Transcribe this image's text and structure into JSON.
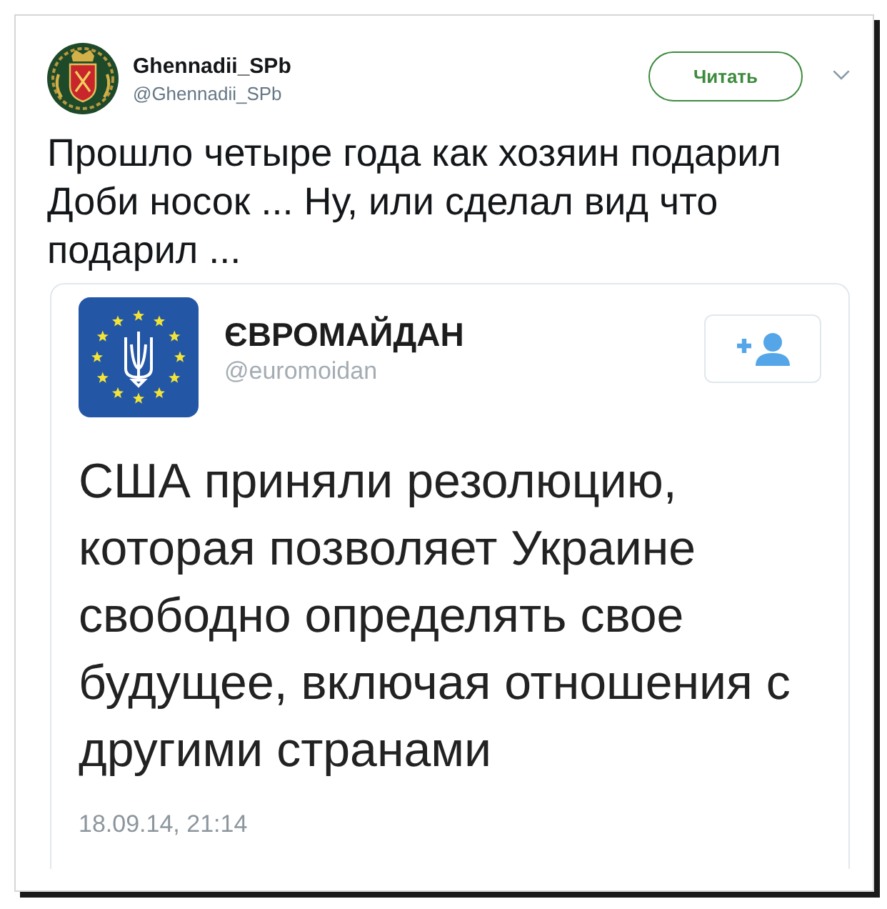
{
  "tweet": {
    "author": {
      "name": "Ghennadii_SPb",
      "handle": "@Ghennadii_SPb"
    },
    "follow_button": {
      "label": "Читать"
    },
    "text": "Прошло четыре года как хозяин подарил Доби носок ... Ну, или сделал вид что подарил ...",
    "embedded_screenshot": {
      "author": {
        "name": "ЄВРОМАЙДАН",
        "handle": "@euromoidan"
      },
      "text": "США приняли резолюцию, которая позволяет Украине свободно определять свое будущее, включая отношения с другими странами",
      "timestamp": "18.09.14, 21:14"
    }
  }
}
